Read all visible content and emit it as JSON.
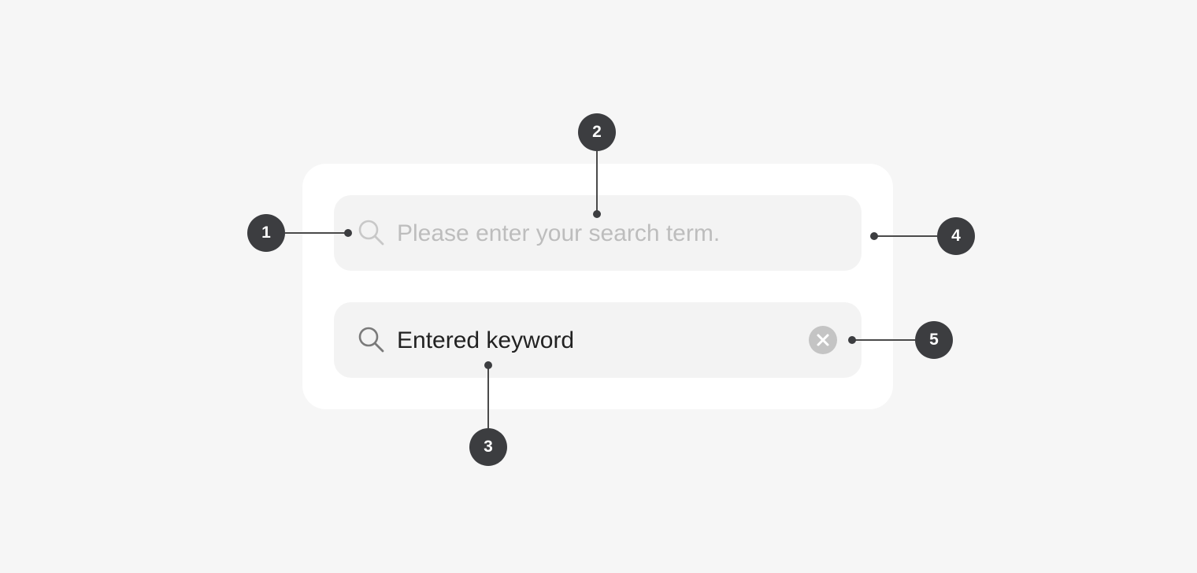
{
  "search_empty": {
    "placeholder": "Please enter your search term.",
    "icon": "search-icon"
  },
  "search_filled": {
    "value": "Entered keyword",
    "icon": "search-icon",
    "clear_icon": "clear-icon"
  },
  "callouts": {
    "c1": "1",
    "c2": "2",
    "c3": "3",
    "c4": "4",
    "c5": "5"
  },
  "colors": {
    "page_background": "#f6f6f6",
    "card_background": "#ffffff",
    "field_background": "#f3f3f3",
    "placeholder_text": "#bdbdbd",
    "value_text": "#222222",
    "marker": "#3c3d40"
  }
}
